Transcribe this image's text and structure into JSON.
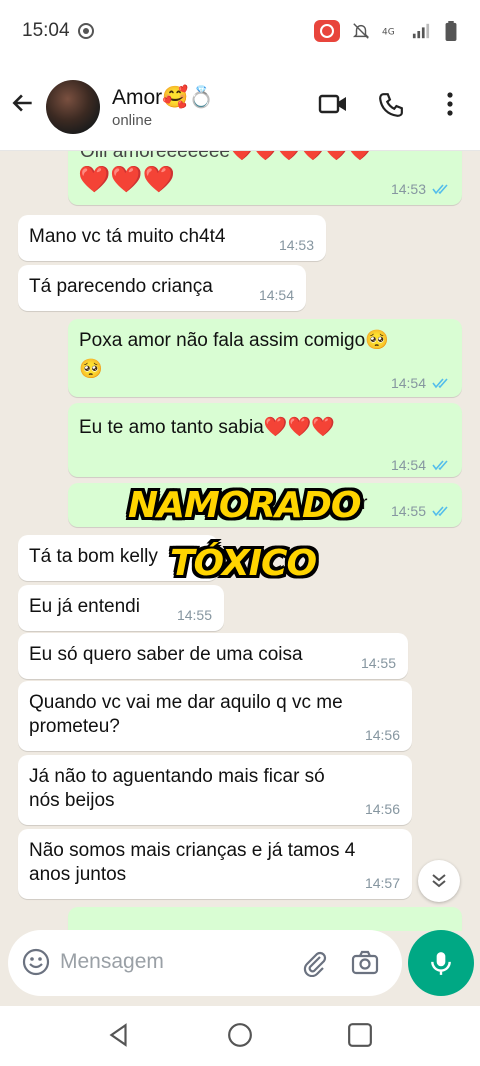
{
  "status_bar": {
    "time": "15:04"
  },
  "header": {
    "contact_name": "Amor🥰💍",
    "contact_status": "online"
  },
  "messages": {
    "m0": {
      "text": "Oiii amoreeeeeee❤️❤️❤️❤️❤️❤️",
      "emojis": "❤️❤️❤️",
      "time": "14:53"
    },
    "m1": {
      "text": "Mano vc tá muito ch4t4",
      "time": "14:53"
    },
    "m2": {
      "text": "Tá parecendo criança",
      "time": "14:54"
    },
    "m3": {
      "line1": "Poxa amor não fala assim comigo🥺",
      "line2": "🥺",
      "time": "14:54"
    },
    "m4": {
      "text": "Eu te amo tanto sabia❤️❤️❤️",
      "time": "14:54"
    },
    "m5": {
      "text": "ber",
      "time": "14:55"
    },
    "m6": {
      "text": "Tá ta bom kelly",
      "time": "14:55"
    },
    "m7": {
      "text": "Eu já entendi",
      "time": "14:55"
    },
    "m8": {
      "text": "Eu só quero saber de uma coisa",
      "time": "14:55"
    },
    "m9": {
      "line1": "Quando vc vai me dar aquilo q vc me",
      "line2": "prometeu?",
      "time": "14:56"
    },
    "m10": {
      "line1": "Já não to aguentando  mais ficar só",
      "line2": "nós beijos",
      "time": "14:56"
    },
    "m11": {
      "line1": "Não somos mais crianças e já tamos 4",
      "line2": "anos juntos",
      "time": "14:57"
    }
  },
  "overlay": {
    "line1": "NAMORADO",
    "line2": "TÓXICO"
  },
  "composer": {
    "placeholder": "Mensagem"
  },
  "colors": {
    "accent": "#00a884",
    "outgoing_bubble": "#d9fdd3",
    "read_ticks": "#53bdeb",
    "overlay_text": "#ffd400"
  }
}
